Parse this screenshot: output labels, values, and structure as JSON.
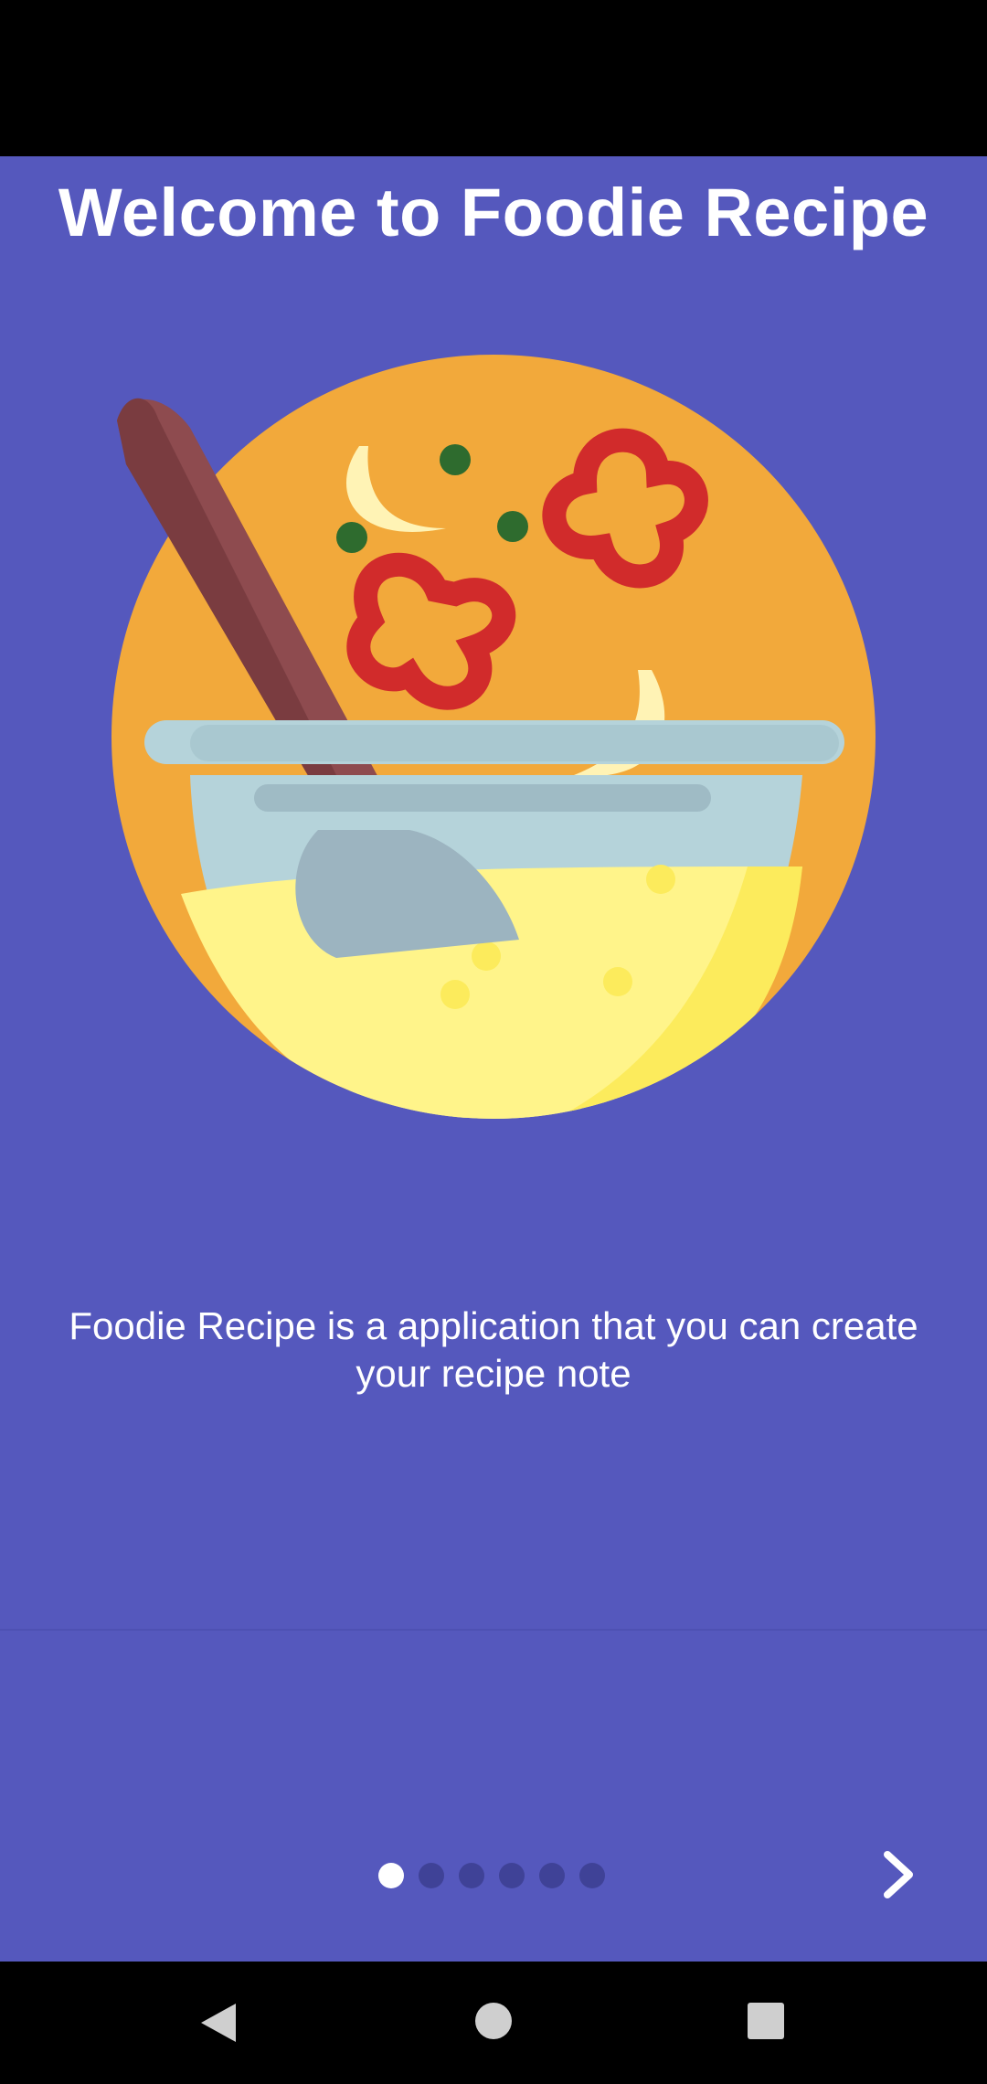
{
  "onboarding": {
    "title": "Welcome to Foodie Recipe",
    "description": "Foodie Recipe is a application that you can create your recipe note",
    "page_indicator": {
      "total": 6,
      "current": 1
    },
    "illustration_icon": "cooking-bowl-icon",
    "next_icon": "chevron-right-icon"
  },
  "colors": {
    "background": "#5558BD",
    "circle": "#F2A93B",
    "spoon": "#8E4B4F",
    "bowl": "#B5D3DA",
    "soup": "#FFF48A",
    "pepper": "#D12B2B",
    "garlic": "#FFF3B5",
    "peas": "#2E6B2E"
  },
  "navigation": {
    "back_icon": "back-triangle-icon",
    "home_icon": "home-circle-icon",
    "recents_icon": "recents-square-icon"
  }
}
